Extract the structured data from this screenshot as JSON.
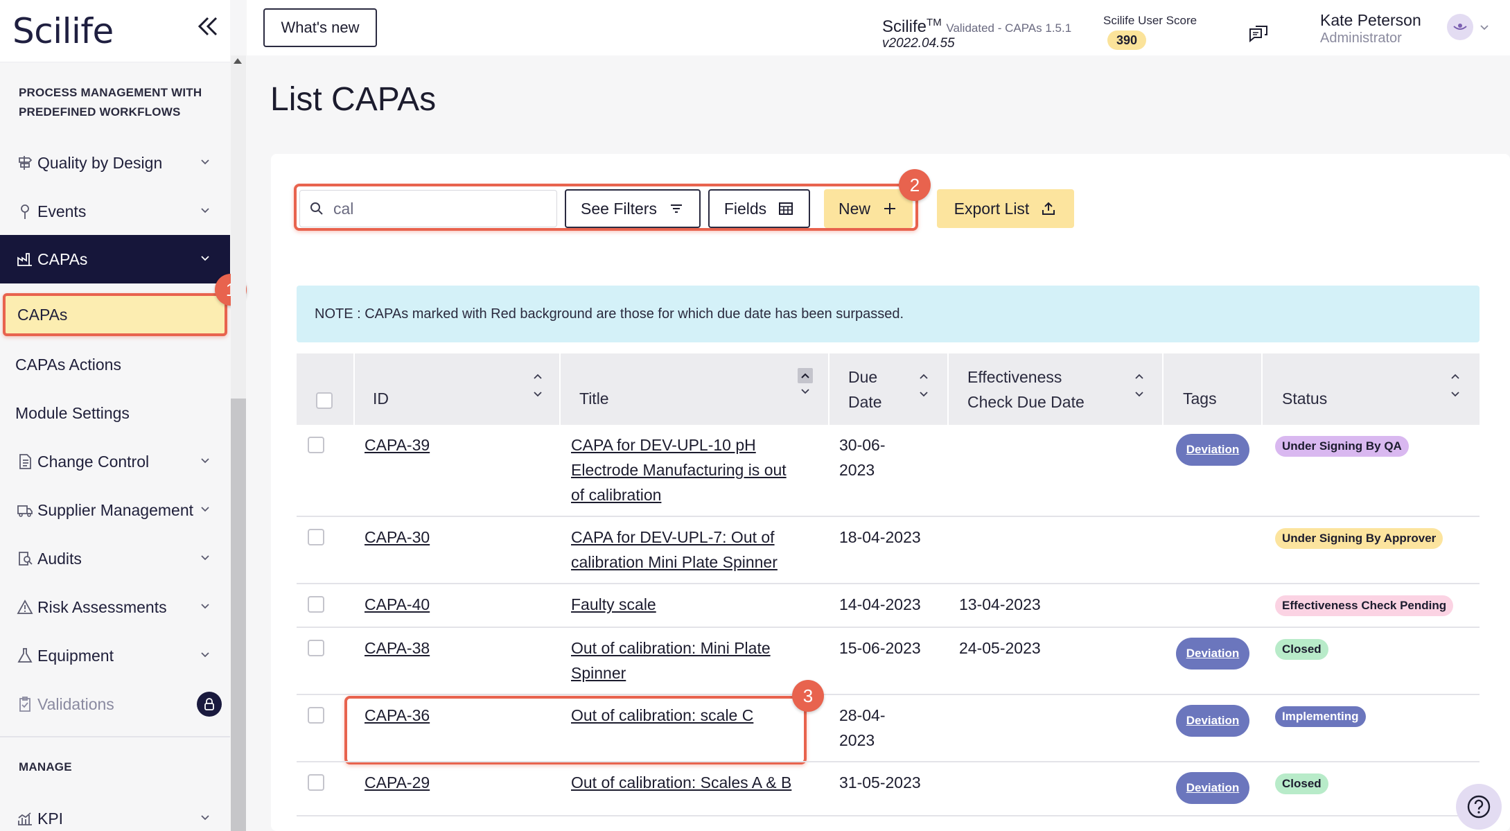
{
  "sidebar": {
    "logo": "Scilife",
    "section_process": "PROCESS MANAGEMENT WITH PREDEFINED WORKFLOWS",
    "items": [
      {
        "label": "Quality by Design",
        "icon": "signpost-icon"
      },
      {
        "label": "Events",
        "icon": "pin-icon"
      },
      {
        "label": "CAPAs",
        "icon": "factory-icon"
      },
      {
        "label": "Change Control",
        "icon": "document-change-icon"
      },
      {
        "label": "Supplier Management",
        "icon": "truck-icon"
      },
      {
        "label": "Audits",
        "icon": "audit-icon"
      },
      {
        "label": "Risk Assessments",
        "icon": "warning-icon"
      },
      {
        "label": "Equipment",
        "icon": "flask-icon"
      },
      {
        "label": "Validations",
        "icon": "clipboard-icon"
      },
      {
        "label": "KPI",
        "icon": "bar-chart-icon"
      }
    ],
    "sub_items": [
      "CAPAs",
      "CAPAs Actions",
      "Module Settings"
    ],
    "section_manage": "MANAGE"
  },
  "header": {
    "whats_new": "What's new",
    "app_name": "Scilife",
    "tm": "TM",
    "validated": "Validated - CAPAs 1.5.1",
    "version": "v2022.04.55",
    "score_label": "Scilife User Score",
    "score_value": "390",
    "user_name": "Kate Peterson",
    "user_role": "Administrator"
  },
  "main": {
    "title": "List CAPAs",
    "search_value": "cal",
    "see_filters": "See Filters",
    "fields": "Fields",
    "new": "New",
    "export_list": "Export List",
    "note": "NOTE : CAPAs marked with Red background are those for which due date has been surpassed.",
    "callouts": [
      "1",
      "2",
      "3"
    ]
  },
  "table": {
    "headers": {
      "id": "ID",
      "title": "Title",
      "due_1": "Due",
      "due_2": "Date",
      "eff_1": "Effectiveness",
      "eff_2": "Check Due Date",
      "tags": "Tags",
      "status": "Status"
    },
    "rows": [
      {
        "id": "CAPA-39",
        "title": [
          "CAPA for DEV-UPL-10 pH",
          "Electrode Manufacturing is out",
          "of calibration"
        ],
        "due": [
          "30-06-",
          "2023"
        ],
        "eff": "",
        "tag": "Deviation",
        "status": "Under Signing By QA",
        "status_color": "#d9b8f0"
      },
      {
        "id": "CAPA-30",
        "title": [
          "CAPA for DEV-UPL-7: Out of",
          "calibration Mini Plate Spinner"
        ],
        "due": [
          "18-04-2023"
        ],
        "eff": "",
        "tag": "",
        "status": "Under Signing By Approver",
        "status_color": "#fce49e"
      },
      {
        "id": "CAPA-40",
        "title": [
          "Faulty scale"
        ],
        "due": [
          "14-04-2023"
        ],
        "eff": "13-04-2023",
        "tag": "",
        "status": "Effectiveness Check Pending",
        "status_color": "#fbd3e3"
      },
      {
        "id": "CAPA-38",
        "title": [
          "Out of calibration: Mini Plate",
          "Spinner"
        ],
        "due": [
          "15-06-2023"
        ],
        "eff": "24-05-2023",
        "tag": "Deviation",
        "status": "Closed",
        "status_color": "#b8ebc9"
      },
      {
        "id": "CAPA-36",
        "title": [
          "Out of calibration: scale C"
        ],
        "due": [
          "28-04-",
          "2023"
        ],
        "eff": "",
        "tag": "Deviation",
        "status": "Implementing",
        "status_color": "#6b76bd"
      },
      {
        "id": "CAPA-29",
        "title": [
          "Out of calibration: Scales A & B"
        ],
        "due": [
          "31-05-2023"
        ],
        "eff": "",
        "tag": "Deviation",
        "status": "Closed",
        "status_color": "#b8ebc9"
      }
    ]
  },
  "colors": {
    "accent_dark": "#16163a",
    "highlight": "#e8634e",
    "yellow": "#fce49e",
    "tag": "#6b76bd"
  }
}
